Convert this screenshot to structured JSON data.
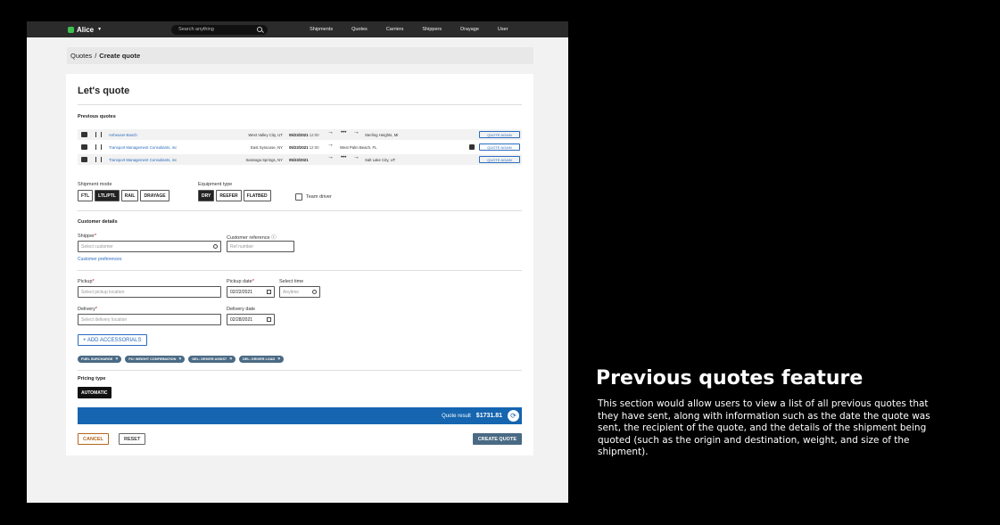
{
  "app": {
    "name": "Alice"
  },
  "search": {
    "placeholder": "Search anything"
  },
  "nav": [
    "Shipments",
    "Quotes",
    "Carriers",
    "Shippers",
    "Drayage",
    "User"
  ],
  "breadcrumb": {
    "parent": "Quotes",
    "separator": "/",
    "current": "Create quote"
  },
  "page_title": "Let's quote",
  "previous_quotes": {
    "heading": "Previous quotes",
    "action_label": "QUOTE AGAIN",
    "rows": [
      {
        "customer": "Anheuser-Busch",
        "origin": "West Valley City, UT",
        "date": "05/23/2021",
        "time": "12:00",
        "dots": "•••",
        "destination": "Sterling Heights, MI"
      },
      {
        "customer": "Transport Management Consultants, inc",
        "origin": "East Syracuse, NY",
        "date": "05/23/2021",
        "time": "12:00",
        "dots": "",
        "destination": "West Palm Beach, FL"
      },
      {
        "customer": "Transport Management Consultants, inc",
        "origin": "Saratoga Springs, NY",
        "date": "05/23/2021",
        "time": "",
        "dots": "•••",
        "destination": "Salt Lake City, UT"
      }
    ]
  },
  "shipment_mode": {
    "label": "Shipment mode",
    "options": [
      "FTL",
      "LTL/PTL",
      "RAIL",
      "DRAYAGE"
    ],
    "selected": "LTL/PTL"
  },
  "equipment_type": {
    "label": "Equipment type",
    "options": [
      "DRY",
      "REEFER",
      "FLATBED"
    ],
    "selected": "DRY"
  },
  "team_driver": {
    "label": "Team driver"
  },
  "customer_details": {
    "heading": "Customer details",
    "shipper_label": "Shipper",
    "shipper_placeholder": "Select customer",
    "ref_label": "Customer reference",
    "ref_placeholder": "Ref number",
    "preferences_link": "Customer preferences"
  },
  "pickup": {
    "label": "Pickup",
    "placeholder": "Select pickup location",
    "date_label": "Pickup date",
    "date_value": "02/22/2021",
    "time_label": "Select time",
    "time_placeholder": "Anytime"
  },
  "delivery": {
    "label": "Delivery",
    "placeholder": "Select delivery location",
    "date_label": "Delivery date",
    "date_value": "02/28/2021"
  },
  "accessorials": {
    "button": "+ ADD ACCESSORIALS",
    "tags": [
      "FUEL SURCHARGE",
      "PU: WEIGHT CONFIRMATION",
      "DEL: DRIVER ASSIST",
      "DEL: DRIVER LOAD"
    ]
  },
  "pricing": {
    "heading": "Pricing type",
    "selected": "AUTOMATIC"
  },
  "quote_result": {
    "label": "Quote result",
    "amount": "$1731.81"
  },
  "actions": {
    "cancel": "CANCEL",
    "reset": "RESET",
    "create": "CREATE QUOTE"
  },
  "required_mark": "*",
  "side_panel": {
    "title": "Previous quotes feature",
    "body": "This section would allow users to view a list of all previous quotes that they have sent, along with information such as the date the quote was sent, the recipient of the quote, and the details of the shipment being quoted (such as the origin and destination, weight, and size of the shipment)."
  },
  "colors": {
    "accent": "#1565b0",
    "link": "#2a6bbf",
    "brand": "#3fbf4f",
    "topbar": "#2b2b2b"
  }
}
